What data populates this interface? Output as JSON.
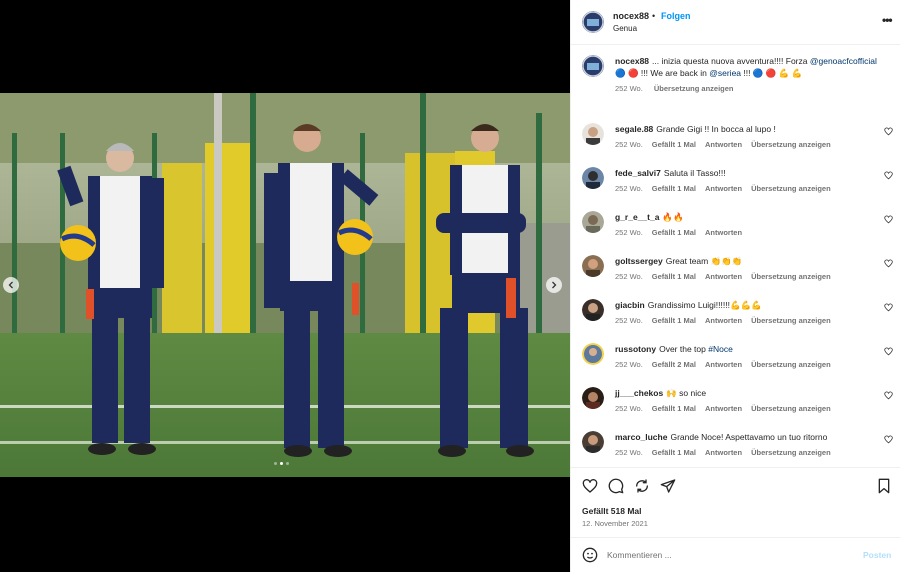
{
  "post": {
    "author": "nocex88",
    "follow_label": "Folgen",
    "location": "Genua",
    "separator": "•"
  },
  "carousel": {
    "total": 3,
    "current": 1
  },
  "caption": {
    "user": "nocex88",
    "text_1": "... inizia questa nuova avventura!!!! Forza",
    "tag_1": "@genoacfcofficial",
    "text_2": " 🔵 🔴 !!! We are back in ",
    "tag_2": "@seriea",
    "text_3": " !!! 🔵 🔴 💪 💪",
    "age": "252 Wo.",
    "translate": "Übersetzung anzeigen"
  },
  "comments": [
    {
      "user": "segale.88",
      "text": "Grande Gigi !! In bocca al lupo !",
      "age": "252 Wo.",
      "likes": "Gefällt 1 Mal",
      "reply": "Antworten",
      "translate": "Übersetzung anzeigen"
    },
    {
      "user": "fede_salvi7",
      "text": "Saluta il Tasso!!!",
      "age": "252 Wo.",
      "likes": "Gefällt 1 Mal",
      "reply": "Antworten",
      "translate": "Übersetzung anzeigen"
    },
    {
      "user": "g_r_e__t_a",
      "text": "🔥🔥",
      "age": "252 Wo.",
      "likes": "Gefällt 1 Mal",
      "reply": "Antworten",
      "translate": ""
    },
    {
      "user": "goltssergey",
      "text": "Great team 👏👏👏",
      "age": "252 Wo.",
      "likes": "Gefällt 1 Mal",
      "reply": "Antworten",
      "translate": "Übersetzung anzeigen"
    },
    {
      "user": "giacbin",
      "text": "Grandissimo Luigi!!!!!!💪💪💪",
      "age": "252 Wo.",
      "likes": "Gefällt 1 Mal",
      "reply": "Antworten",
      "translate": "Übersetzung anzeigen"
    },
    {
      "user": "russotony",
      "text": "Over the top ",
      "tag": "#Noce",
      "age": "252 Wo.",
      "likes": "Gefällt 2 Mal",
      "reply": "Antworten",
      "translate": "Übersetzung anzeigen"
    },
    {
      "user": "jj___chekos",
      "text": "🙌 so nice",
      "age": "252 Wo.",
      "likes": "Gefällt 1 Mal",
      "reply": "Antworten",
      "translate": "Übersetzung anzeigen"
    },
    {
      "user": "marco_luche",
      "text": "Grande Noce! Aspettavamo un tuo ritorno",
      "age": "252 Wo.",
      "likes": "Gefällt 1 Mal",
      "reply": "Antworten",
      "translate": "Übersetzung anzeigen"
    }
  ],
  "footer": {
    "likes": "Gefällt 518 Mal",
    "date": "12. November 2021",
    "comment_placeholder": "Kommentieren ...",
    "post_label": "Posten"
  },
  "colors": {
    "accent": "#0095f6",
    "tag": "#00376b",
    "muted": "#737373",
    "post_disabled": "#b2dffc"
  },
  "icons": {
    "more": "more-options-icon",
    "like": "heart-icon",
    "comment": "comment-icon",
    "share": "share-icon",
    "send": "send-icon",
    "save": "bookmark-icon",
    "emoji": "emoji-icon",
    "prev": "chevron-left-icon",
    "next": "chevron-right-icon"
  }
}
